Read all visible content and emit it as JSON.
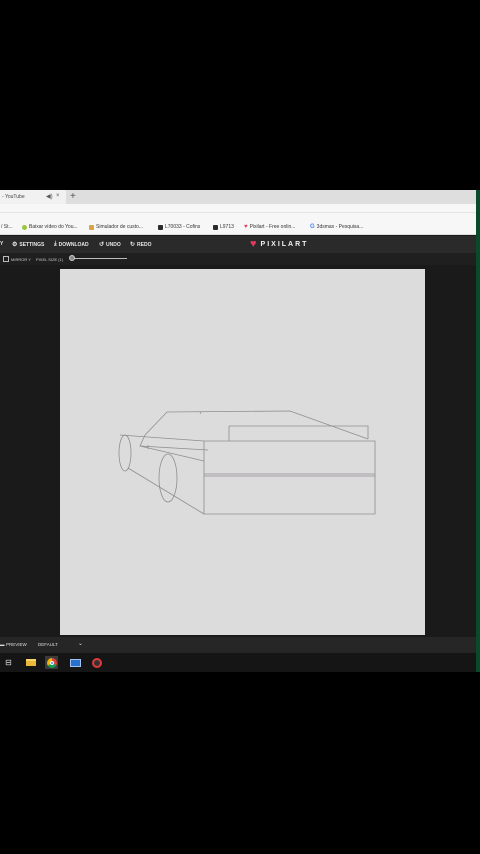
{
  "browser": {
    "tab_title": "- YouTube",
    "new_tab_symbol": "+",
    "close_symbol": "×",
    "speaker_symbol": "◀)",
    "bookmarks": [
      {
        "label": "/ St...",
        "icon": "blank",
        "color": "#ffffff"
      },
      {
        "label": "Baixar vídeo do You...",
        "icon": "download-icon",
        "color": "#9bc53d"
      },
      {
        "label": "Simulador de custo...",
        "icon": "link-icon",
        "color": "#d9a441"
      },
      {
        "label": "L70033 - Cofins",
        "icon": "doc-icon",
        "color": "#2b2b2b"
      },
      {
        "label": "L9713",
        "icon": "doc-icon",
        "color": "#2b2b2b"
      },
      {
        "label": "Pixilart - Free onlin...",
        "icon": "heart-icon",
        "color": "#e03a5a"
      },
      {
        "label": "3dsmax - Pesquisa...",
        "icon": "google-icon",
        "color": "#4285f4"
      }
    ]
  },
  "toolbar": {
    "menu_symbol": "Y",
    "settings_label": "SETTINGS",
    "download_label": "DOWNLOAD",
    "undo_label": "UNDO",
    "redo_label": "REDO",
    "logo_text": "PIXILART",
    "brand_color": "#e03a5a"
  },
  "options": {
    "mirror_label": "MIRROR Y",
    "pixel_size_label": "PIXEL SIZE (1)",
    "mirror_checked": false
  },
  "bottom": {
    "preview_label": "PREVIEW",
    "mode_label": "DEFAULT",
    "dropdown_symbol": "⌄"
  },
  "taskbar": {
    "items": [
      "task-view-icon",
      "file-explorer-icon",
      "chrome-icon",
      "mail-icon",
      "app-icon"
    ]
  }
}
